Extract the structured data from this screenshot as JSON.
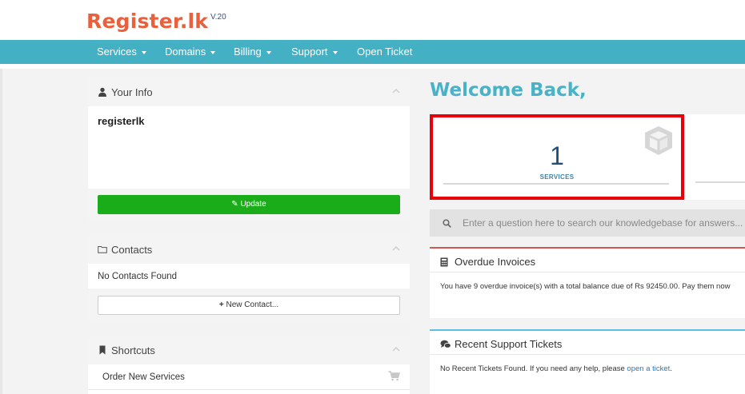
{
  "brand": {
    "name": "Register.lk",
    "version": "V.20"
  },
  "nav": {
    "items": [
      {
        "label": "Services",
        "dropdown": true
      },
      {
        "label": "Domains",
        "dropdown": true
      },
      {
        "label": "Billing",
        "dropdown": true
      },
      {
        "label": "Support",
        "dropdown": true
      },
      {
        "label": "Open Ticket",
        "dropdown": false
      }
    ]
  },
  "your_info": {
    "title": "Your Info",
    "name": "registerlk",
    "update_label": "Update"
  },
  "contacts": {
    "title": "Contacts",
    "empty_text": "No Contacts Found",
    "new_label": "New Contact..."
  },
  "shortcuts": {
    "title": "Shortcuts",
    "items": [
      {
        "label": "Order New Services"
      }
    ]
  },
  "welcome": {
    "title": "Welcome Back,"
  },
  "stats": {
    "services": {
      "count": "1",
      "label": "SERVICES"
    }
  },
  "kb_search": {
    "placeholder": "Enter a question here to search our knowledgebase for answers..."
  },
  "overdue": {
    "title": "Overdue Invoices",
    "text": "You have 9 overdue invoice(s) with a total balance due of Rs 92450.00. Pay them now"
  },
  "tickets": {
    "title": "Recent Support Tickets",
    "text": "No Recent Tickets Found. If you need any help, please ",
    "link": "open a ticket",
    "suffix": "."
  },
  "colors": {
    "brand": "#e8603c",
    "nav": "#43b0c4",
    "accent": "#47b2c8",
    "success": "#1aad19",
    "highlight": "#e8000b",
    "overdue": "#d9534f"
  },
  "icons": [
    "user-icon",
    "folder-icon",
    "bookmark-icon",
    "pencil-icon",
    "plus-icon",
    "cart-icon",
    "cube-icon",
    "search-icon",
    "calculator-icon",
    "comments-icon",
    "chevron-up-icon"
  ]
}
